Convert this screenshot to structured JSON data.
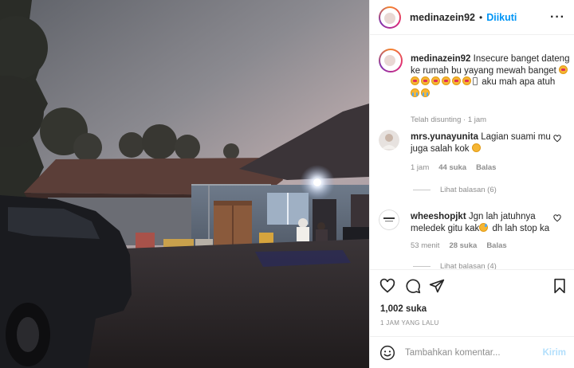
{
  "post": {
    "username": "medinazein92",
    "dot": "•",
    "follow_label": "Diikuti",
    "more_icon": "more-horizontal-icon"
  },
  "caption": {
    "username": "medinazein92",
    "text_part1": "Insecure banget dateng ke rumah bu yayang mewah banget",
    "text_part2": "aku mah apa atuh",
    "edited": "Telah disunting · 1 jam"
  },
  "comments": [
    {
      "username": "mrs.yunayunita",
      "text": "Lagian suami mu juga salah kok",
      "time": "1 jam",
      "likes": "44 suka",
      "reply": "Balas",
      "view_replies": "Lihat balasan (6)"
    },
    {
      "username": "wheeshopjkt",
      "text_part1": "Jgn lah jatuhnya meledek gitu kak",
      "text_part2": "dh lah stop ka",
      "time": "53 menit",
      "likes": "28 suka",
      "reply": "Balas",
      "view_replies": "Lihat balasan (4)"
    }
  ],
  "likes_count": "1,002 suka",
  "posted_time": "1 JAM YANG LALU",
  "add_comment": {
    "placeholder": "Tambahkan komentar...",
    "send_label": "Kirim"
  },
  "colors": {
    "link_blue": "#0095f6",
    "muted": "#8e8e8e",
    "send_disabled": "#b2dffc"
  }
}
